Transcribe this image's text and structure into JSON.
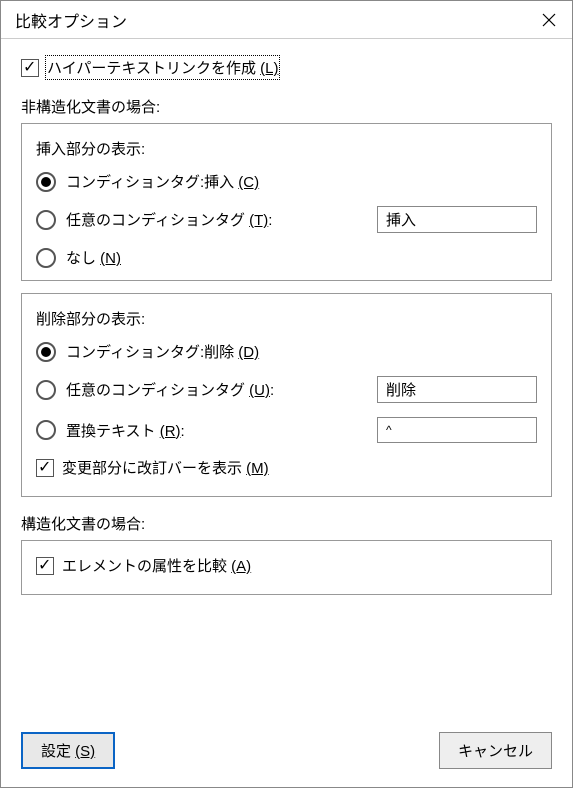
{
  "title": "比較オプション",
  "hypertext": {
    "label": "ハイパーテキストリンクを作成 ",
    "mnemonic": "(L)",
    "checked": true
  },
  "unstructured_label": "非構造化文書の場合:",
  "insert": {
    "title": "挿入部分の表示:",
    "option_condition": {
      "label": "コンディションタグ:挿入 ",
      "mnemonic": "(C)"
    },
    "option_custom": {
      "label": "任意のコンディションタグ ",
      "mnemonic": "(T)",
      "suffix": ":"
    },
    "custom_value": "挿入",
    "option_none": {
      "label": "なし ",
      "mnemonic": "(N)"
    }
  },
  "delete": {
    "title": "削除部分の表示:",
    "option_condition": {
      "label": "コンディションタグ:削除 ",
      "mnemonic": "(D)"
    },
    "option_custom": {
      "label": "任意のコンディションタグ ",
      "mnemonic": "(U)",
      "suffix": ":"
    },
    "custom_value": "削除",
    "option_replace": {
      "label": "置換テキスト ",
      "mnemonic": "(R)",
      "suffix": ":"
    },
    "replace_value": "^",
    "show_bar": {
      "label": "変更部分に改訂バーを表示 ",
      "mnemonic": "(M)",
      "checked": true
    }
  },
  "structured_label": "構造化文書の場合:",
  "compare_attrs": {
    "label": "エレメントの属性を比較 ",
    "mnemonic": "(A)",
    "checked": true
  },
  "buttons": {
    "set": {
      "label": "設定 ",
      "mnemonic": "(S)"
    },
    "cancel": "キャンセル"
  }
}
